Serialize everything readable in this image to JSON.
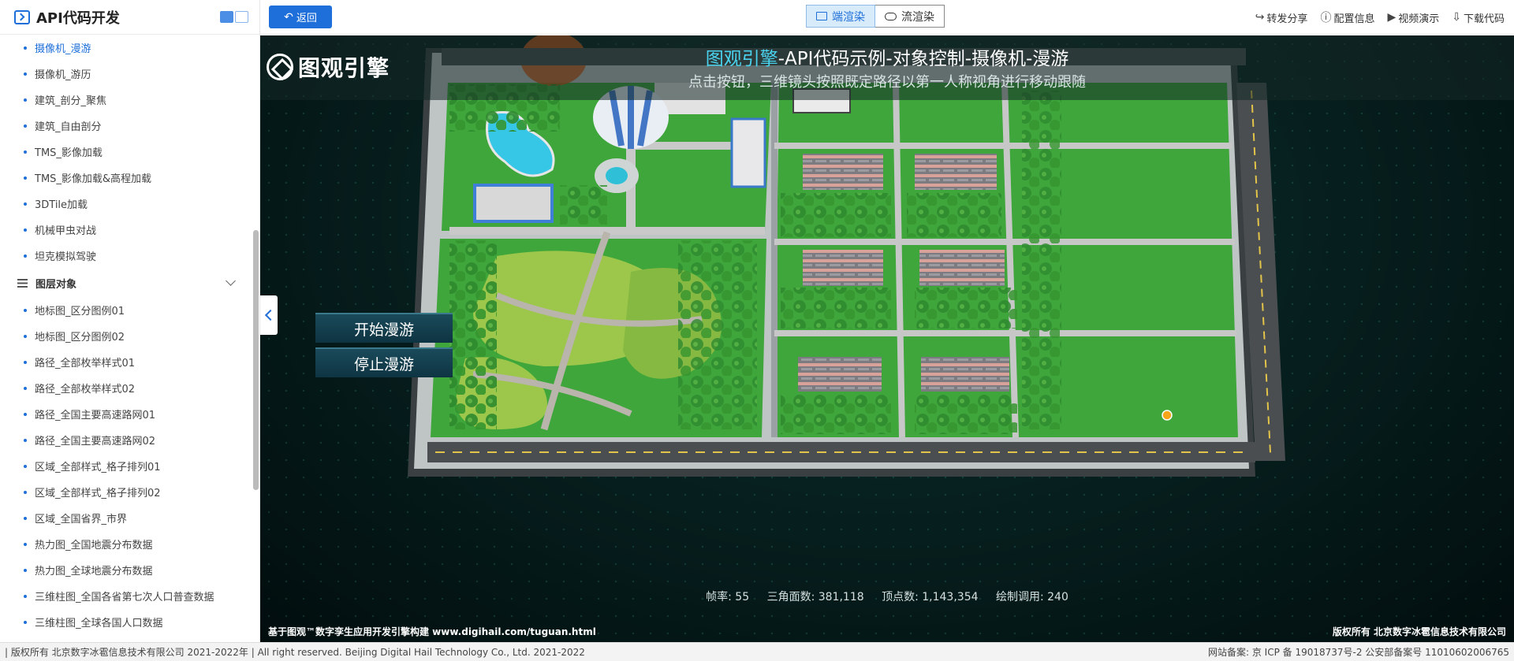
{
  "sidebar": {
    "title": "API代码开发",
    "items_top": [
      {
        "label": "摄像机_漫游",
        "active": true
      },
      {
        "label": "摄像机_游历"
      },
      {
        "label": "建筑_剖分_聚焦"
      },
      {
        "label": "建筑_自由剖分"
      },
      {
        "label": "TMS_影像加载"
      },
      {
        "label": "TMS_影像加载&高程加载"
      },
      {
        "label": "3DTile加载"
      },
      {
        "label": "机械甲虫对战"
      },
      {
        "label": "坦克模拟驾驶"
      }
    ],
    "group_label": "图层对象",
    "items_group": [
      {
        "label": "地标图_区分图例01"
      },
      {
        "label": "地标图_区分图例02"
      },
      {
        "label": "路径_全部枚举样式01"
      },
      {
        "label": "路径_全部枚举样式02"
      },
      {
        "label": "路径_全国主要高速路网01"
      },
      {
        "label": "路径_全国主要高速路网02"
      },
      {
        "label": "区域_全部样式_格子排列01"
      },
      {
        "label": "区域_全部样式_格子排列02"
      },
      {
        "label": "区域_全国省界_市界"
      },
      {
        "label": "热力图_全国地震分布数据"
      },
      {
        "label": "热力图_全球地震分布数据"
      },
      {
        "label": "三维柱图_全国各省第七次人口普查数据"
      },
      {
        "label": "三维柱图_全球各国人口数据"
      }
    ]
  },
  "topbar": {
    "back_label": "返回",
    "render_client": "端渲染",
    "render_stream": "流渲染",
    "actions": [
      "转发分享",
      "配置信息",
      "视频演示",
      "下载代码"
    ]
  },
  "viewer": {
    "brand": "图观引擎",
    "title_highlight": "图观引擎",
    "title_rest": "-API代码示例-对象控制-摄像机-漫游",
    "subtitle": "点击按钮，三维镜头按照既定路径以第一人称视角进行移动跟随",
    "start_tour": "开始漫游",
    "stop_tour": "停止漫游",
    "stats": {
      "fps": "帧率:  55",
      "triangles": "三角面数:  381,118",
      "vertices": "顶点数:  1,143,354",
      "draw_calls": "绘制调用:  240"
    },
    "footer_left": "基于图观™数字孪生应用开发引擎构建 www.digihail.com/tuguan.html",
    "footer_right": "版权所有 北京数字冰雹信息技术有限公司"
  },
  "bottombar": {
    "left": "| 版权所有 北京数字冰雹信息技术有限公司 2021-2022年 | All right reserved. Beijing Digital Hail Technology Co., Ltd. 2021-2022",
    "right": "网站备案: 京 ICP 备 19018737号-2 公安部备案号 11010602006765"
  },
  "colors": {
    "accent": "#1e6fd9",
    "title_highlight": "#4ad3ef",
    "grass": "#3fa63b"
  }
}
